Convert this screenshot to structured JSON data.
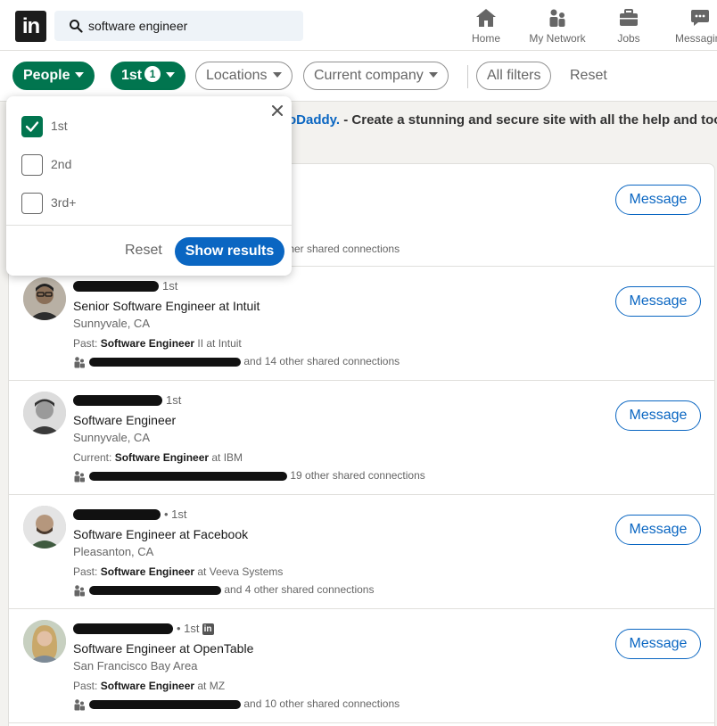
{
  "search": {
    "value": "software engineer",
    "placeholder": "Search"
  },
  "nav": [
    {
      "label": "Home",
      "icon": "home-icon"
    },
    {
      "label": "My Network",
      "icon": "network-icon"
    },
    {
      "label": "Jobs",
      "icon": "briefcase-icon"
    },
    {
      "label": "Messaging",
      "icon": "messaging-icon"
    }
  ],
  "filters": {
    "people": "People",
    "connections": "1st",
    "connections_count": "1",
    "locations": "Locations",
    "current_company": "Current company",
    "all_filters": "All filters",
    "reset": "Reset"
  },
  "promo": {
    "brand": "oDaddy.",
    "text": " - Create a stunning and secure site with all the help and too"
  },
  "dropdown": {
    "options": [
      {
        "label": "1st",
        "checked": true
      },
      {
        "label": "2nd",
        "checked": false
      },
      {
        "label": "3rd+",
        "checked": false
      }
    ],
    "reset": "Reset",
    "show_results": "Show results"
  },
  "results": [
    {
      "degree": "",
      "headline": "",
      "location": "",
      "extra_prefix": "",
      "extra_bold": "",
      "extra_suffix": "",
      "shared": "ther shared connections",
      "message": "Message"
    },
    {
      "degree": "1st",
      "headline": "Senior Software Engineer at Intuit",
      "location": "Sunnyvale, CA",
      "extra_prefix": "Past: ",
      "extra_bold": "Software Engineer",
      "extra_suffix": " II at Intuit",
      "shared": "and 14 other shared connections",
      "message": "Message"
    },
    {
      "degree": "1st",
      "headline": "Software Engineer",
      "location": "Sunnyvale, CA",
      "extra_prefix": "Current: ",
      "extra_bold": "Software Engineer",
      "extra_suffix": " at IBM",
      "shared": "19 other shared connections",
      "message": "Message"
    },
    {
      "degree": "• 1st",
      "headline": "Software Engineer at Facebook",
      "location": "Pleasanton, CA",
      "extra_prefix": "Past: ",
      "extra_bold": "Software Engineer",
      "extra_suffix": " at Veeva Systems",
      "shared": "and 4 other shared connections",
      "message": "Message"
    },
    {
      "degree": "• 1st",
      "headline": "Software Engineer at OpenTable",
      "location": "San Francisco Bay Area",
      "extra_prefix": "Past: ",
      "extra_bold": "Software Engineer",
      "extra_suffix": " at MZ",
      "shared": "and 10 other shared connections",
      "message": "Message"
    }
  ],
  "colors": {
    "accent_green": "#01754f",
    "link_blue": "#0a66c2",
    "page_bg": "#f3f2ef"
  }
}
